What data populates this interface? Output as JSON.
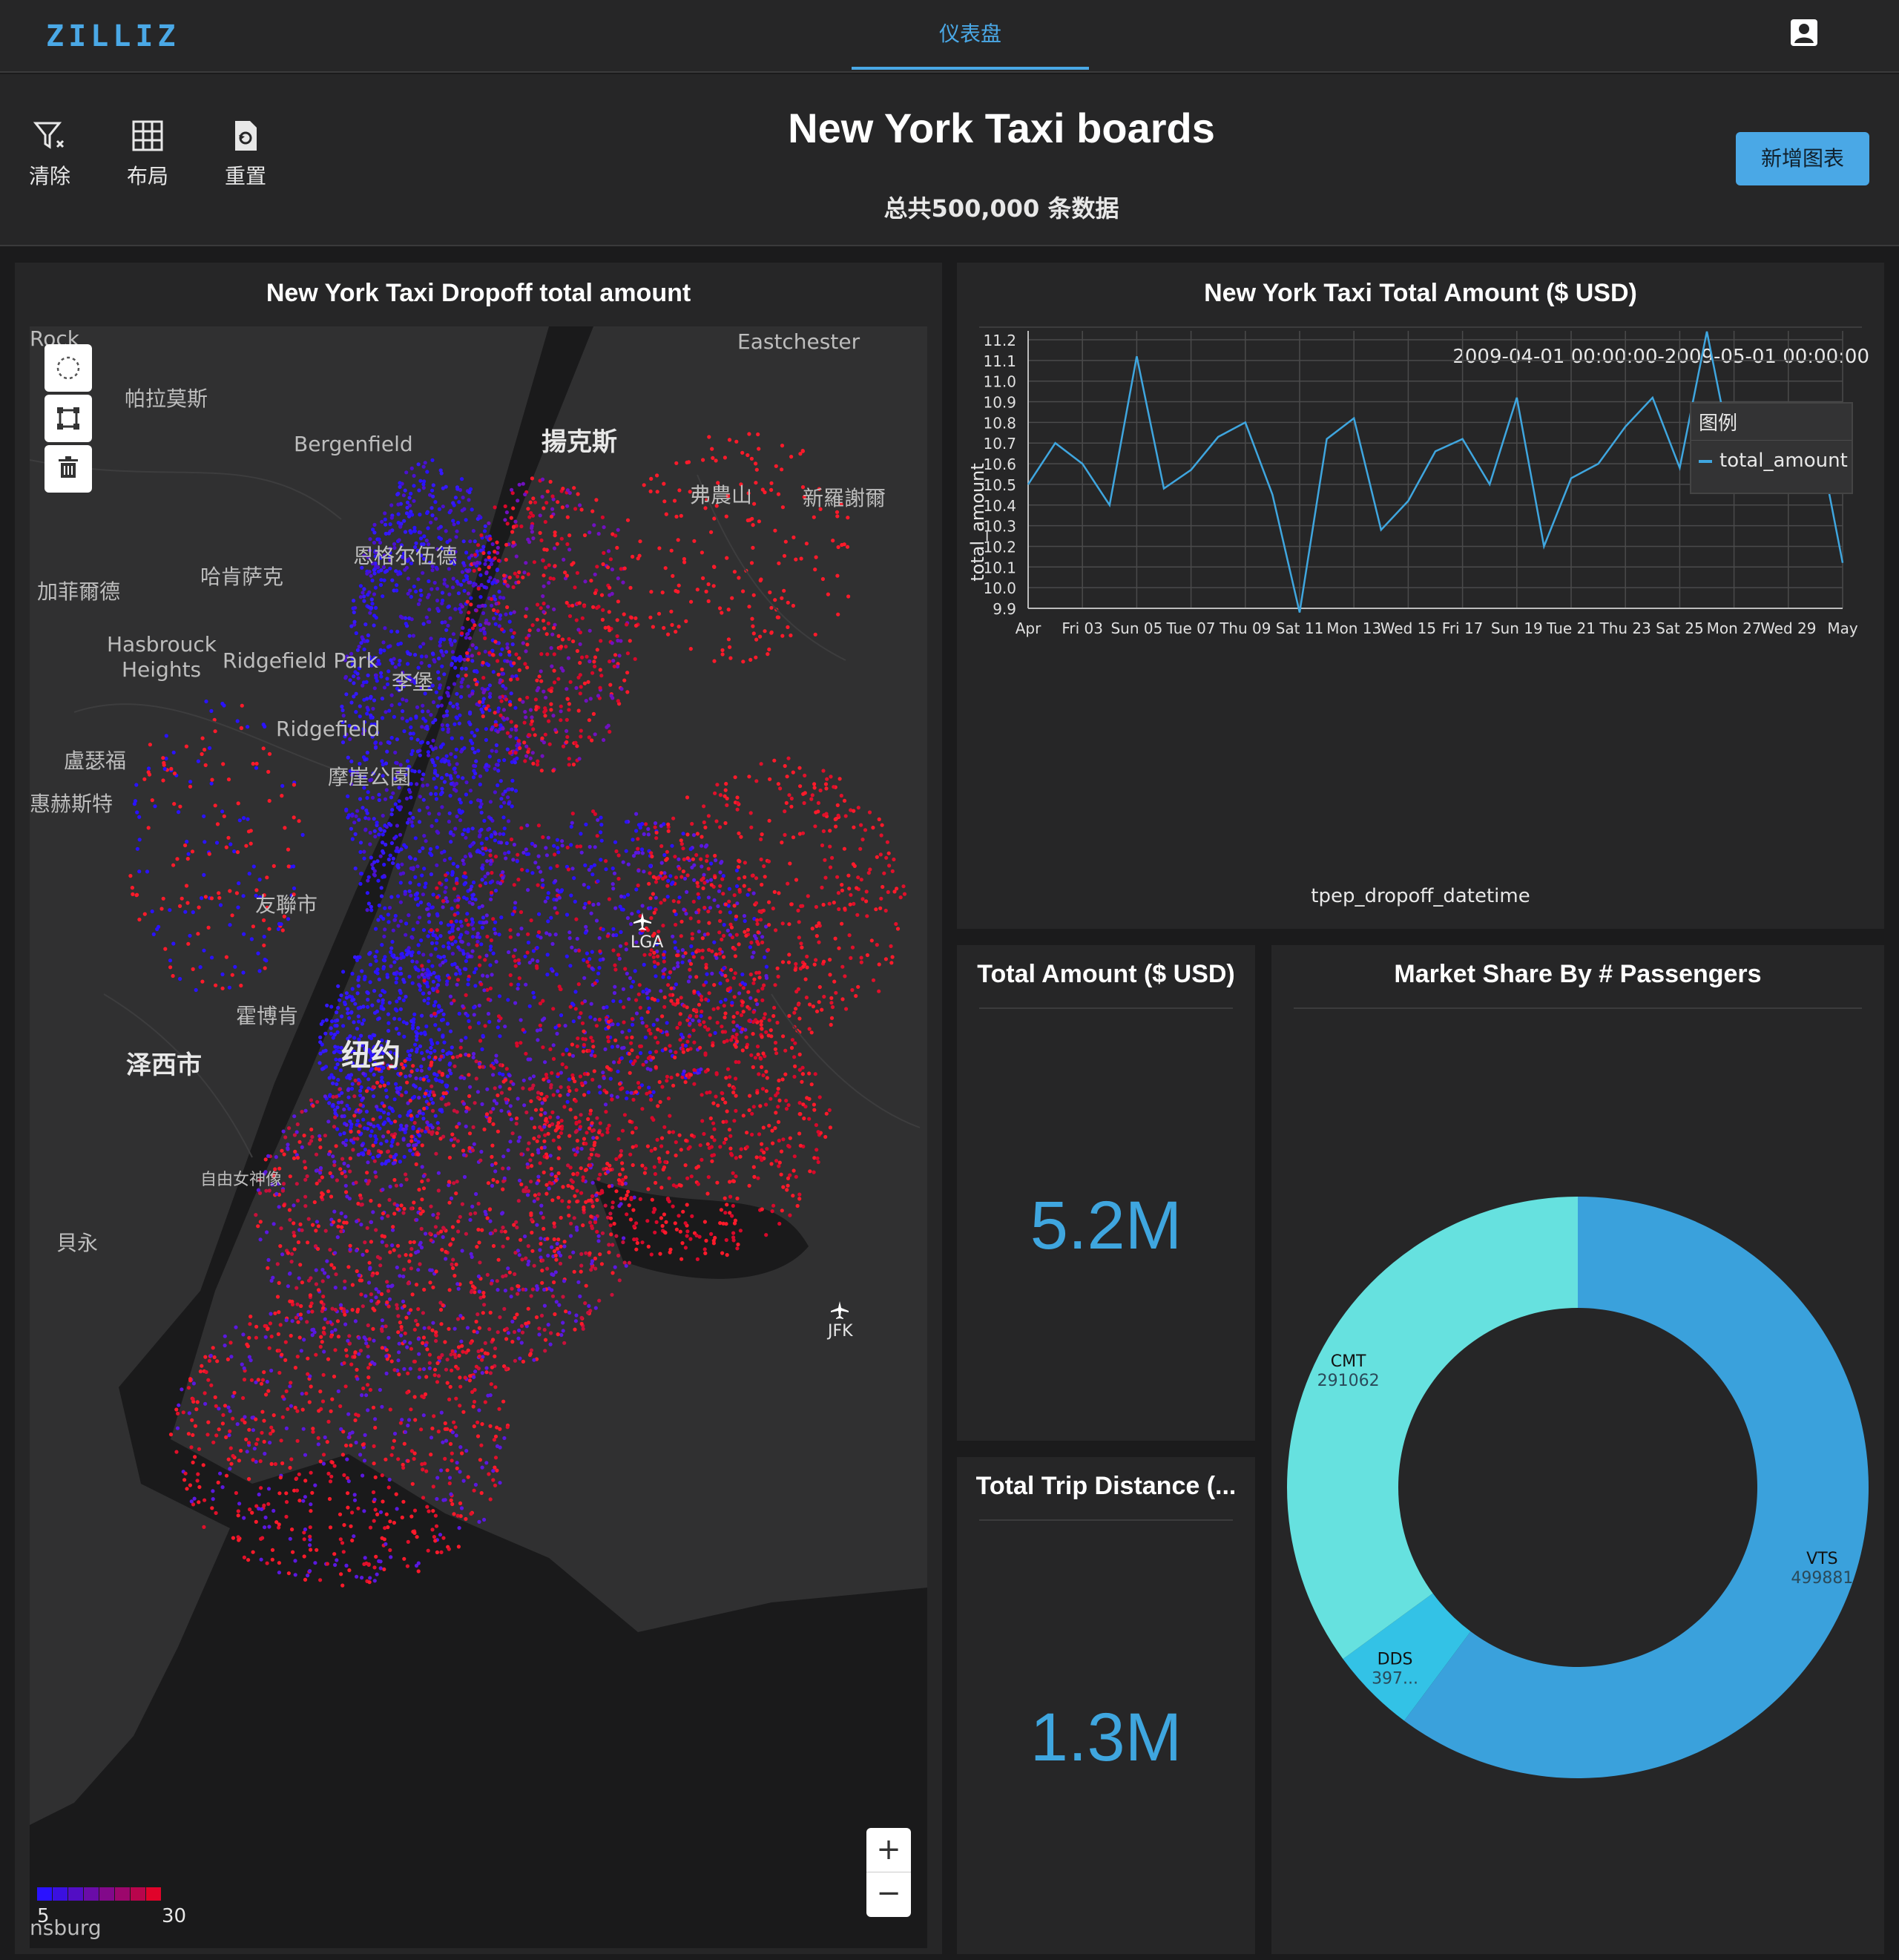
{
  "app": {
    "logo": "ZILLIZ",
    "nav_tab": "仪表盘"
  },
  "toolbar": {
    "clear": "清除",
    "layout": "布局",
    "reset": "重置",
    "add_chart": "新增图表"
  },
  "header": {
    "title": "New York Taxi boards",
    "subtitle": "总共500,000 条数据"
  },
  "map_panel": {
    "title": "New York Taxi Dropoff total amount",
    "labels": [
      "Rock",
      "Eastchester",
      "帕拉莫斯",
      "Bergenfield",
      "揚克斯",
      "弗農山",
      "新羅謝爾",
      "恩格尔伍德",
      "哈肯萨克",
      "加菲爾德",
      "Hasbrouck",
      "Heights",
      "Ridgefield Park",
      "李堡",
      "Ridgefield",
      "盧瑟福",
      "惠赫斯特",
      "摩崖公園",
      "友聯市",
      "LGA",
      "霍博肯",
      "纽约",
      "泽西市",
      "自由女神像",
      "貝永",
      "JFK",
      "nsburg"
    ],
    "legend": {
      "min": "5",
      "max": "30"
    },
    "zoom_in": "+",
    "zoom_out": "−"
  },
  "line_panel": {
    "title": "New York Taxi Total Amount ($ USD)",
    "range": "2009-04-01 00:00:00-2009-05-01 00:00:00",
    "legend_title": "图例",
    "legend_item": "total_amount"
  },
  "kpi1": {
    "title": "Total Amount ($ USD)",
    "value": "5.2M"
  },
  "kpi2": {
    "title": "Total Trip Distance (...",
    "value": "1.3M"
  },
  "pie_panel": {
    "title": "Market Share By # Passengers"
  },
  "chart_data": [
    {
      "type": "line",
      "xlabel": "tpep_dropoff_datetime",
      "ylabel": "total_amount",
      "ylim": [
        9.9,
        11.2
      ],
      "y_ticks": [
        "9.9",
        "10.0",
        "10.1",
        "10.2",
        "10.3",
        "10.4",
        "10.5",
        "10.6",
        "10.7",
        "10.8",
        "10.9",
        "11.0",
        "11.1",
        "11.2"
      ],
      "x_ticks": [
        "Apr",
        "Fri 03",
        "Sun 05",
        "Tue 07",
        "Thu 09",
        "Sat 11",
        "Mon 13",
        "Wed 15",
        "Fri 17",
        "Sun 19",
        "Tue 21",
        "Thu 23",
        "Sat 25",
        "Mon 27",
        "Wed 29",
        "May"
      ],
      "grid": true,
      "legend": "top-right",
      "series": [
        {
          "name": "total_amount",
          "color": "#3fa6df",
          "values": [
            10.5,
            10.7,
            10.6,
            10.4,
            11.12,
            10.48,
            10.57,
            10.73,
            10.8,
            10.45,
            9.88,
            10.72,
            10.82,
            10.28,
            10.42,
            10.66,
            10.72,
            10.5,
            10.92,
            10.2,
            10.53,
            10.6,
            10.78,
            10.92,
            10.58,
            11.24,
            10.58,
            10.51,
            10.59,
            10.8,
            10.12
          ]
        }
      ]
    },
    {
      "type": "pie",
      "donut": true,
      "slices": [
        {
          "label": "VTS",
          "value_label": "499881",
          "value": 499881,
          "color": "#3aa1dc"
        },
        {
          "label": "DDS",
          "value_label": "397...",
          "value": 39700,
          "color": "#33c2e6"
        },
        {
          "label": "CMT",
          "value_label": "291062",
          "value": 291062,
          "color": "#66e1df"
        }
      ]
    }
  ]
}
